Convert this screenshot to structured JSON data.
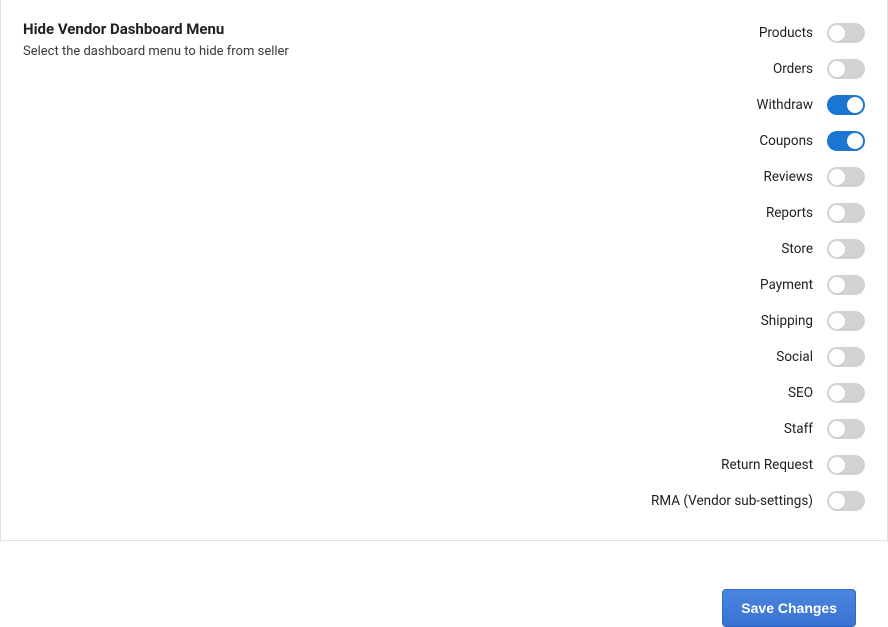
{
  "section": {
    "title": "Hide Vendor Dashboard Menu",
    "description": "Select the dashboard menu to hide from seller"
  },
  "toggles": [
    {
      "label": "Products",
      "on": false
    },
    {
      "label": "Orders",
      "on": false
    },
    {
      "label": "Withdraw",
      "on": true
    },
    {
      "label": "Coupons",
      "on": true
    },
    {
      "label": "Reviews",
      "on": false
    },
    {
      "label": "Reports",
      "on": false
    },
    {
      "label": "Store",
      "on": false
    },
    {
      "label": "Payment",
      "on": false
    },
    {
      "label": "Shipping",
      "on": false
    },
    {
      "label": "Social",
      "on": false
    },
    {
      "label": "SEO",
      "on": false
    },
    {
      "label": "Staff",
      "on": false
    },
    {
      "label": "Return Request",
      "on": false
    },
    {
      "label": "RMA (Vendor sub-settings)",
      "on": false
    }
  ],
  "footer": {
    "save_label": "Save Changes"
  }
}
